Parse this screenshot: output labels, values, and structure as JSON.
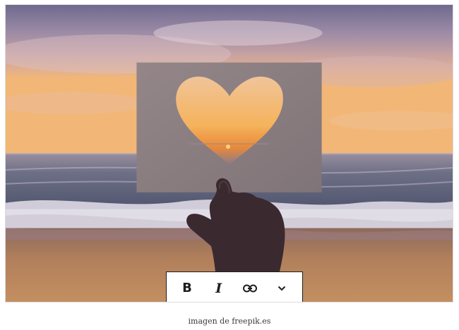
{
  "image": {
    "alt": "Papel con recorte en forma de corazón frente a un atardecer en la playa"
  },
  "toolbar": {
    "bold_label": "B",
    "italic_label": "I",
    "link_icon": "link-icon",
    "more_icon": "chevron-down-icon"
  },
  "caption": {
    "text": "imagen de freepik.es"
  }
}
